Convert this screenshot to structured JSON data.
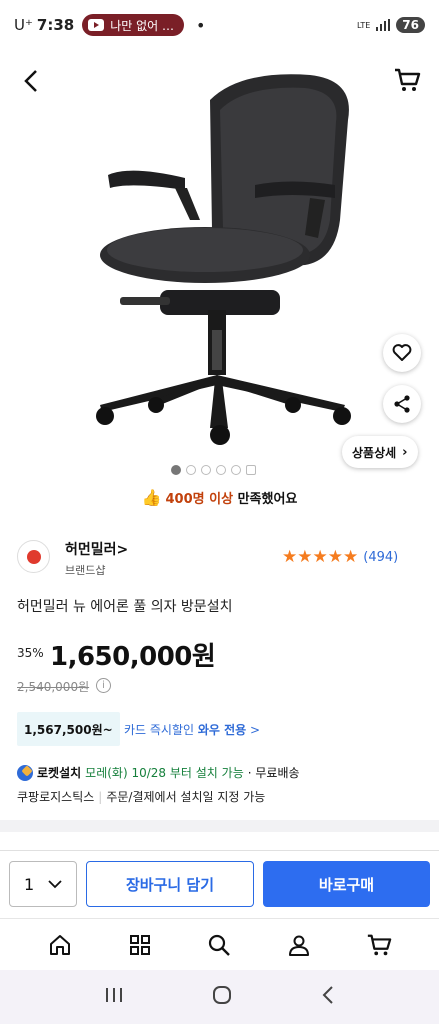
{
  "status_bar": {
    "carrier": "U⁺",
    "time": "7:38",
    "notification": "나만 없어 …",
    "dot": "•",
    "network": "LTE",
    "battery": "76"
  },
  "product": {
    "image_icon": "office-chair",
    "detail_button": "상품상세",
    "carousel": {
      "total": 6,
      "active": 1
    },
    "satisfaction_prefix": "400명 이상",
    "satisfaction_suffix": " 만족했어요",
    "brand_name": "허먼밀러",
    "brand_chevron": ">",
    "brand_sub": "브랜드샵",
    "rating": 5,
    "review_count": "(494)",
    "title": "허먼밀러 뉴 에어론 풀 의자 방문설치",
    "discount": "35%",
    "price": "1,650,000원",
    "original_price": "2,540,000원",
    "info_symbol": "i",
    "card_price": "1,567,500원~",
    "card_text_prefix": "카드 즉시할인 ",
    "card_text_bold": "와우 전용",
    "card_chevron": " >",
    "delivery_label": "로켓설치",
    "delivery_date": "모레(화) 10/28 부터 설치 가능",
    "delivery_extra": "· 무료배송",
    "shipper": "쿠팡로지스틱스",
    "shipper_note": "주문/결제에서 설치일 지정 가능"
  },
  "actions": {
    "quantity": "1",
    "add_to_cart": "장바구니 담기",
    "buy_now": "바로구매"
  },
  "colors": {
    "primary_blue": "#2d6df0",
    "star_orange": "#f57c1f",
    "highlight_orange": "#c2410c",
    "green": "#16803c"
  },
  "bottom_nav": [
    "home-icon",
    "category-icon",
    "search-icon",
    "my-page-icon",
    "cart-icon"
  ]
}
